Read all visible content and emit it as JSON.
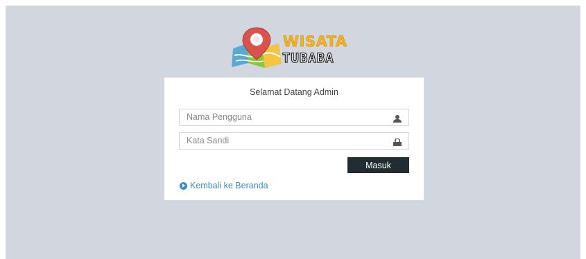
{
  "logo": {
    "line1": "WISATA",
    "line2": "TUBABA",
    "icon": "map-pin-icon"
  },
  "login": {
    "title": "Selamat Datang Admin",
    "username": {
      "placeholder": "Nama Pengguna",
      "value": "",
      "icon": "user-icon"
    },
    "password": {
      "placeholder": "Kata Sandi",
      "value": "",
      "icon": "lock-icon"
    },
    "submit_label": "Masuk",
    "back_link": {
      "label": "Kembali ke Beranda",
      "icon": "arrow-circle-right-icon"
    }
  },
  "colors": {
    "page_background": "#d2d6df",
    "button": "#222d32",
    "link": "#3c8dbc",
    "logo_accent": "#f5b21d"
  }
}
